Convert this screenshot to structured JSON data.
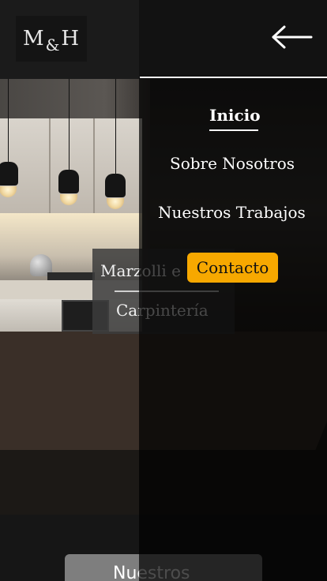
{
  "header": {
    "logo": {
      "left": "M",
      "amp": "&",
      "right": "H"
    }
  },
  "hero": {
    "brand_line1": "Marzolli e",
    "brand_line2": "Carpintería"
  },
  "next_section": {
    "title": "Nuestros"
  },
  "menu": {
    "items": [
      {
        "label": "Inicio",
        "active": true
      },
      {
        "label": "Sobre Nosotros"
      },
      {
        "label": "Nuestros Trabajos"
      },
      {
        "label": "Contacto",
        "highlight": true
      }
    ],
    "accent_color": "#f7a800"
  },
  "icons": {
    "back": "arrow-left-icon"
  }
}
